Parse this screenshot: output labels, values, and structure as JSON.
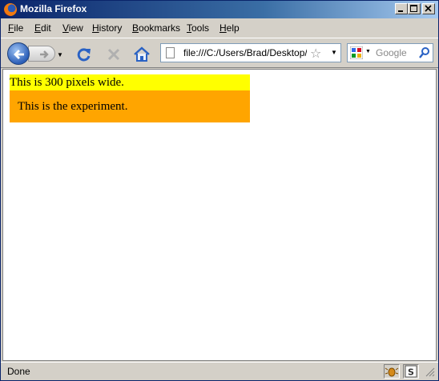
{
  "window": {
    "title": "Mozilla Firefox"
  },
  "menu": [
    {
      "label": "File",
      "key": "F",
      "rest": "ile"
    },
    {
      "label": "Edit",
      "key": "E",
      "rest": "dit"
    },
    {
      "label": "View",
      "key": "V",
      "rest": "iew"
    },
    {
      "label": "History",
      "key": "H",
      "rest": "istory"
    },
    {
      "label": "Bookmarks",
      "key": "B",
      "rest": "ookmarks"
    },
    {
      "label": "Tools",
      "key": "T",
      "rest": "ools"
    },
    {
      "label": "Help",
      "key": "H",
      "rest": "elp"
    }
  ],
  "toolbar": {
    "url": "file:///C:/Users/Brad/Desktop/test.html",
    "search_placeholder": "Google"
  },
  "content": {
    "yellow_text": "This is 300 pixels wide.",
    "orange_text": "This is the experiment."
  },
  "status": {
    "text": "Done"
  },
  "colors": {
    "yellow_box": "#ffff00",
    "orange_box": "#ffa500"
  }
}
